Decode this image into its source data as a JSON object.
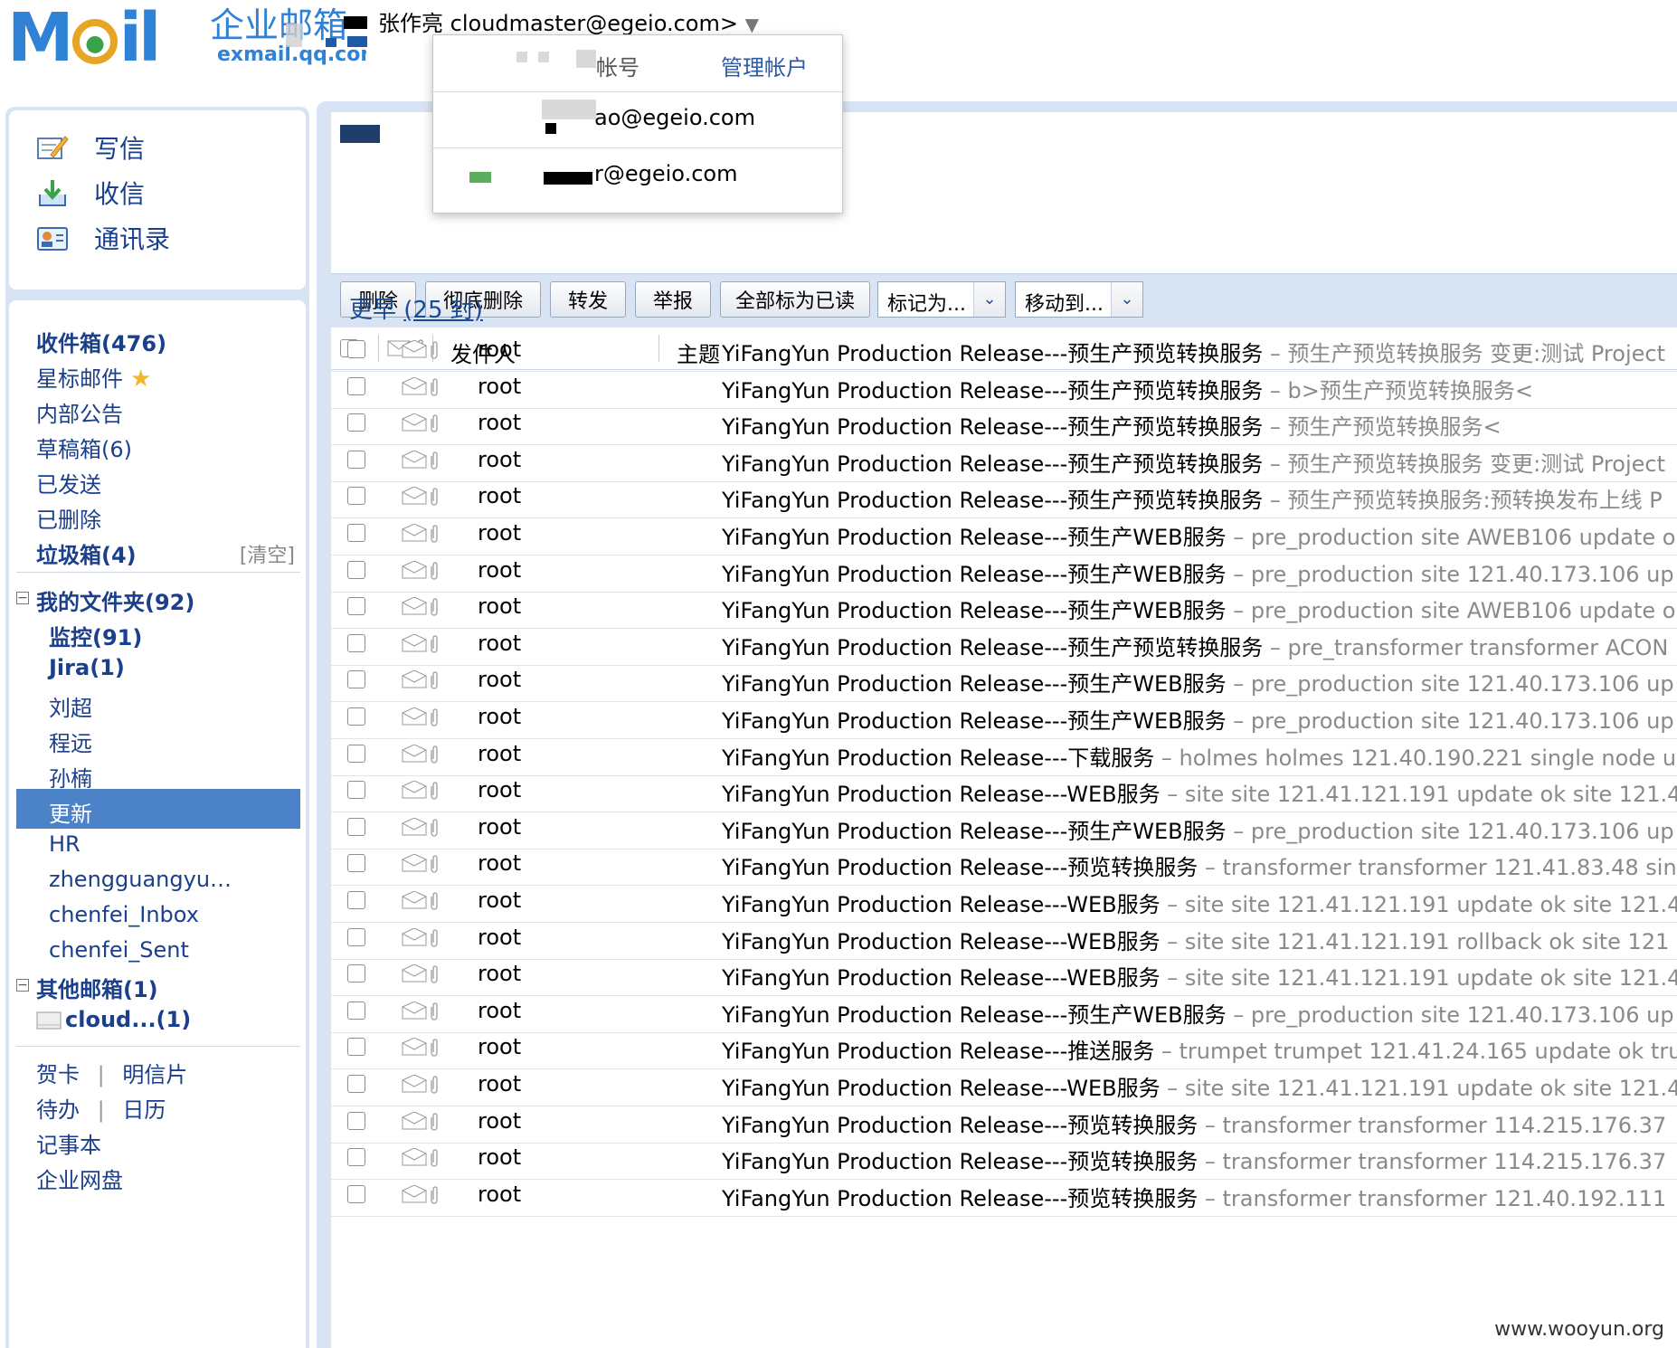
{
  "header": {
    "logo_text": "MOil",
    "logo_cn": "企业邮箱",
    "logo_sub": "exmail.qq.com",
    "user_line_prefix": "张作亮",
    "user_line_email": "cloudmaster@egeio.com>",
    "user_arrow": "▼"
  },
  "account_menu": {
    "account_label": "帐号",
    "manage_label": "管理帐户",
    "row2_email": "ao@egeio.com",
    "row3_email": "r@egeio.com"
  },
  "quick": {
    "compose": "写信",
    "receive": "收信",
    "contacts": "通讯录"
  },
  "folders": {
    "inbox": "收件箱(476)",
    "starred": "星标邮件",
    "notice": "内部公告",
    "drafts": "草稿箱(6)",
    "sent": "已发送",
    "deleted": "已删除",
    "spam": "垃圾箱(4)",
    "spam_clear": "[清空]",
    "my_folders": "我的文件夹(92)",
    "my_folders_toggle": "−",
    "sub": [
      "监控(91)",
      "Jira(1)",
      "刘超",
      "程远",
      "孙楠",
      "更新",
      "HR",
      "zhengguangyu…",
      "chenfei_Inbox",
      "chenfei_Sent"
    ],
    "other": "其他邮箱(1)",
    "other_toggle": "−",
    "cloud": "cloud...(1)",
    "links": {
      "card": "贺卡",
      "postcard": "明信片",
      "sep": "|",
      "todo": "待办",
      "calendar": "日历",
      "notes": "记事本",
      "disk": "企业网盘"
    }
  },
  "toolbar": {
    "delete": "删除",
    "perm_delete": "彻底删除",
    "forward": "转发",
    "report": "举报",
    "mark_all_read": "全部标为已读",
    "mark_as": "标记为...",
    "move_to": "移动到...",
    "dropdown_arrow": "⌄"
  },
  "columns": {
    "from": "发件人",
    "subject": "主题"
  },
  "group": {
    "label": "更早",
    "count": "(25 封)"
  },
  "mails": [
    {
      "from": "root",
      "subject": "YiFangYun Production Release---预生产预览转换服务",
      "preview": " – 预生产预览转换服务 变更:测试 Project"
    },
    {
      "from": "root",
      "subject": "YiFangYun Production Release---预生产预览转换服务",
      "preview": " – b>预生产预览转换服务<"
    },
    {
      "from": "root",
      "subject": "YiFangYun Production Release---预生产预览转换服务",
      "preview": " – 预生产预览转换服务<"
    },
    {
      "from": "root",
      "subject": "YiFangYun Production Release---预生产预览转换服务",
      "preview": " – 预生产预览转换服务 变更:测试 Project"
    },
    {
      "from": "root",
      "subject": "YiFangYun Production Release---预生产预览转换服务",
      "preview": " – 预生产预览转换服务:预转换发布上线 P"
    },
    {
      "from": "root",
      "subject": "YiFangYun Production Release---预生产WEB服务",
      "preview": " – pre_production site AWEB106 update ok"
    },
    {
      "from": "root",
      "subject": "YiFangYun Production Release---预生产WEB服务",
      "preview": " – pre_production site 121.40.173.106 up"
    },
    {
      "from": "root",
      "subject": "YiFangYun Production Release---预生产WEB服务",
      "preview": " – pre_production site AWEB106 update ok"
    },
    {
      "from": "root",
      "subject": "YiFangYun Production Release---预生产预览转换服务",
      "preview": " – pre_transformer transformer ACON"
    },
    {
      "from": "root",
      "subject": "YiFangYun Production Release---预生产WEB服务",
      "preview": " – pre_production site 121.40.173.106 up"
    },
    {
      "from": "root",
      "subject": "YiFangYun Production Release---预生产WEB服务",
      "preview": " – pre_production site 121.40.173.106 up"
    },
    {
      "from": "root",
      "subject": "YiFangYun Production Release---下载服务",
      "preview": " – holmes holmes 121.40.190.221 single node u"
    },
    {
      "from": "root",
      "subject": "YiFangYun Production  Release---WEB服务",
      "preview": " – site site 121.41.121.191 update ok site 121.4"
    },
    {
      "from": "root",
      "subject": "YiFangYun Production Release---预生产WEB服务",
      "preview": " – pre_production site 121.40.173.106 up"
    },
    {
      "from": "root",
      "subject": "YiFangYun Production Release---预览转换服务",
      "preview": " – transformer transformer 121.41.83.48 sin"
    },
    {
      "from": "root",
      "subject": "YiFangYun Production  Release---WEB服务",
      "preview": " – site site 121.41.121.191 update ok site 121.4"
    },
    {
      "from": "root",
      "subject": "YiFangYun Production  Release---WEB服务",
      "preview": " – site site 121.41.121.191 rollback ok site 121"
    },
    {
      "from": "root",
      "subject": "YiFangYun Production  Release---WEB服务",
      "preview": " – site site 121.41.121.191 update ok site 121.4"
    },
    {
      "from": "root",
      "subject": "YiFangYun Production Release---预生产WEB服务",
      "preview": " – pre_production site 121.40.173.106 up"
    },
    {
      "from": "root",
      "subject": "YiFangYun Production Release---推送服务",
      "preview": " – trumpet trumpet 121.41.24.165 update ok tru"
    },
    {
      "from": "root",
      "subject": "YiFangYun Production  Release---WEB服务",
      "preview": " – site site 121.41.121.191 update ok site 121.4"
    },
    {
      "from": "root",
      "subject": "YiFangYun Production Release---预览转换服务",
      "preview": " – transformer transformer 114.215.176.37"
    },
    {
      "from": "root",
      "subject": "YiFangYun Production Release---预览转换服务",
      "preview": " – transformer transformer 114.215.176.37"
    },
    {
      "from": "root",
      "subject": "YiFangYun Production Release---预览转换服务",
      "preview": " – transformer transformer 121.40.192.111"
    }
  ],
  "watermark": "www.wooyun.org",
  "colors": {
    "accent": "#2f82d6",
    "frame": "#d8e4f3",
    "link": "#1a3f8c",
    "selected": "#4c82c8"
  }
}
